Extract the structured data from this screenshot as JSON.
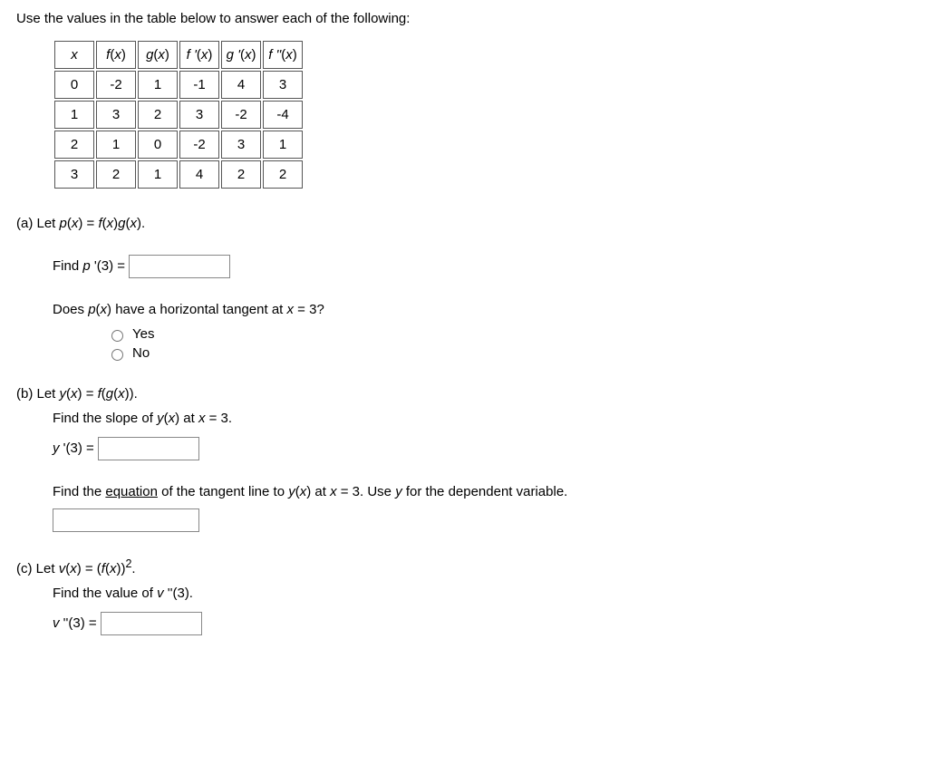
{
  "intro_text": "Use the values in the table below to answer each of the following:",
  "table": {
    "headers": [
      "x",
      "f(x)",
      "g(x)",
      "f '(x)",
      "g '(x)",
      "f ''(x)"
    ],
    "rows": [
      [
        "0",
        "-2",
        "1",
        "-1",
        "4",
        "3"
      ],
      [
        "1",
        "3",
        "2",
        "3",
        "-2",
        "-4"
      ],
      [
        "2",
        "1",
        "0",
        "-2",
        "3",
        "1"
      ],
      [
        "3",
        "2",
        "1",
        "4",
        "2",
        "2"
      ]
    ]
  },
  "part_a": {
    "prefix": "(a) Let ",
    "def_lhs": "p",
    "def_arg": "(x)",
    "def_eq": " = ",
    "def_rhs_f": "f",
    "def_rhs_g": "g",
    "def_rhs_full_tail": "(x).",
    "find_text_pre": "Find ",
    "find_lhs_p": "p ",
    "find_arg": "'(3) = ",
    "tangent_q_pre": "Does ",
    "tangent_q_mid": " have a horizontal tangent at ",
    "tangent_q_x": "x",
    "tangent_q_tail": " = 3?",
    "yes": "Yes",
    "no": "No"
  },
  "part_b": {
    "prefix": "(b) Let ",
    "def": "y(x) = f(g(x)).",
    "slope_pre": "Find the slope of ",
    "slope_mid": "y(x)",
    "slope_at": " at ",
    "slope_x": "x",
    "slope_tail": " = 3.",
    "yprime": "y '(3) = ",
    "eqline_pre": "Find the ",
    "eqline_u": "equation",
    "eqline_mid1": " of the tangent line to ",
    "eqline_yx": "y(x)",
    "eqline_at": " at ",
    "eqline_x": "x",
    "eqline_mid2": " = 3. Use ",
    "eqline_y": "y",
    "eqline_tail": " for the dependent variable."
  },
  "part_c": {
    "prefix": "(c) Let ",
    "def": "v(x) = (f(x))²",
    "def_dot": ".",
    "find_pre": "Find the value of ",
    "find_v": "v ",
    "find_tail": "''(3).",
    "vpp": "v ''(3) = "
  }
}
